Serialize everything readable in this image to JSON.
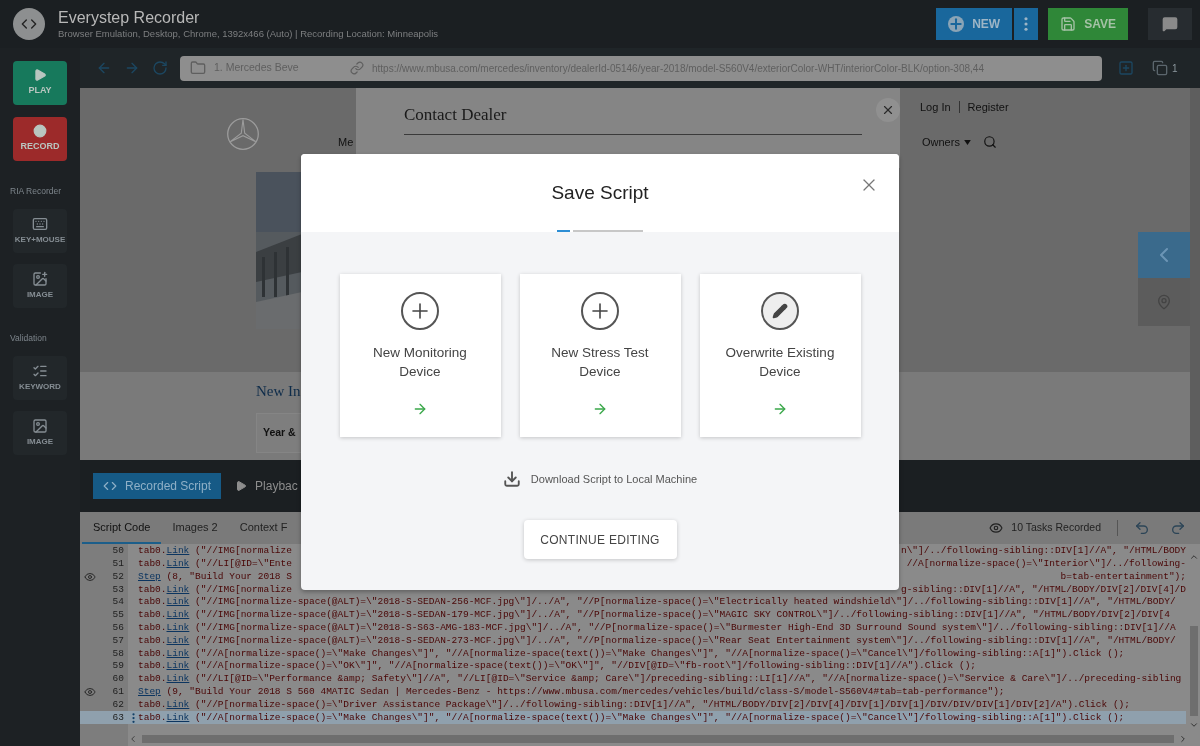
{
  "app": {
    "title": "Everystep Recorder",
    "subtitle": "Browser Emulation, Desktop, Chrome, 1392x466 (Auto) | Recording Location: Minneapolis"
  },
  "header_buttons": [
    {
      "kind": "new",
      "label": "NEW"
    },
    {
      "kind": "more"
    },
    {
      "kind": "save",
      "label": "SAVE"
    },
    {
      "kind": "chat"
    }
  ],
  "sidebar": {
    "primary": [
      {
        "kind": "play",
        "label": "PLAY"
      },
      {
        "kind": "record",
        "label": "RECORD"
      }
    ],
    "sections": [
      {
        "title": "RIA Recorder",
        "items": [
          {
            "kind": "key-mouse",
            "label": "KEY+MOUSE"
          },
          {
            "label": "IMAGE"
          }
        ]
      },
      {
        "title": "Validation",
        "items": [
          {
            "kind": "keyword",
            "label": "KEYWORD"
          },
          {
            "kind": "image-check",
            "label": "IMAGE"
          }
        ]
      }
    ]
  },
  "browser": {
    "tab_title": "1. Mercedes Beve",
    "url": "https://www.mbusa.com/mercedes/inventory/dealerId-05146/year-2018/model-S560V4/exteriorColor-WHT/interiorColor-BLK/option-308,44",
    "tab_count": "1"
  },
  "web_page": {
    "nav_fragment": "Me",
    "top_links": [
      "Log In",
      "Register"
    ],
    "menu": "Owners",
    "contact_panel": {
      "title": "Contact Dealer"
    },
    "heading_fragment": "New In",
    "filter_fragment": "Year &"
  },
  "bottom_tabs": [
    {
      "kind": "code",
      "label": "Recorded Script",
      "selected": true
    },
    {
      "kind": "play",
      "label": "Playbac",
      "selected": false
    }
  ],
  "sub_tabs": [
    {
      "label": "Script Code",
      "selected": true
    },
    {
      "label": "Images",
      "count": "2",
      "selected": false
    },
    {
      "label": "Context F",
      "selected": false
    }
  ],
  "tasks_recorded": "10 Tasks Recorded",
  "code_lines": [
    {
      "number": "50",
      "watched": false,
      "current": false,
      "object": "tab0.",
      "method": "Link",
      "args": " (\"//IMG[normalize",
      "args_right": "n\\\"]/../following-sibling::DIV[1]//A\", \"/HTML/BODY"
    },
    {
      "number": "51",
      "watched": false,
      "current": false,
      "object": "tab0.",
      "method": "Link",
      "args": " (\"//LI[@ID=\\\"Ente",
      "args_right": "//A[normalize-space()=\\\"Interior\\\"]/../following-"
    },
    {
      "number": "52",
      "watched": true,
      "current": false,
      "method": "Step",
      "args": " (8, \"Build Your 2018 S",
      "args_right": "b=tab-entertainment\");"
    },
    {
      "number": "53",
      "watched": false,
      "current": false,
      "object": "tab0.",
      "method": "Link",
      "args": " (\"//IMG[normalize",
      "args_right": "g-sibling::DIV[1]//A\", \"/HTML/BODY/DIV[2]/DIV[4]/D"
    },
    {
      "number": "54",
      "watched": false,
      "current": false,
      "object": "tab0.",
      "method": "Link",
      "args": " (\"//IMG[normalize-space(@ALT)=\\\"2018-S-SEDAN-256-MCF.jpg\\\"]/../A\", \"//P[normalize-space()=\\\"Electrically heated windshield\\\"]/../following-sibling::DIV[1]//A\", \"/HTML/BODY/"
    },
    {
      "number": "55",
      "watched": false,
      "current": false,
      "object": "tab0.",
      "method": "Link",
      "args": " (\"//IMG[normalize-space(@ALT)=\\\"2018-S-SEDAN-179-MCF.jpg\\\"]/../A\", \"//P[normalize-space()=\\\"MAGIC SKY CONTROL\\\"]/../following-sibling::DIV[1]//A\", \"/HTML/BODY/DIV[2]/DIV[4"
    },
    {
      "number": "56",
      "watched": false,
      "current": false,
      "object": "tab0.",
      "method": "Link",
      "args": " (\"//IMG[normalize-space(@ALT)=\\\"2018-S-S63-AMG-183-MCF.jpg\\\"]/../A\", \"//P[normalize-space()=\\\"Burmester High-End 3D Surround Sound system\\\"]/../following-sibling::DIV[1]//A"
    },
    {
      "number": "57",
      "watched": false,
      "current": false,
      "object": "tab0.",
      "method": "Link",
      "args": " (\"//IMG[normalize-space(@ALT)=\\\"2018-S-SEDAN-273-MCF.jpg\\\"]/../A\", \"//P[normalize-space()=\\\"Rear Seat Entertainment system\\\"]/../following-sibling::DIV[1]//A\", \"/HTML/BODY/"
    },
    {
      "number": "58",
      "watched": false,
      "current": false,
      "object": "tab0.",
      "method": "Link",
      "args": " (\"//A[normalize-space()=\\\"Make Changes\\\"]\", \"//A[normalize-space(text())=\\\"Make Changes\\\"]\", \"//A[normalize-space()=\\\"Cancel\\\"]/following-sibling::A[1]\").Click ();"
    },
    {
      "number": "59",
      "watched": false,
      "current": false,
      "object": "tab0.",
      "method": "Link",
      "args": " (\"//A[normalize-space()=\\\"OK\\\"]\", \"//A[normalize-space(text())=\\\"OK\\\"]\", \"//DIV[@ID=\\\"fb-root\\\"]/following-sibling::DIV[1]//A\").Click ();"
    },
    {
      "number": "60",
      "watched": false,
      "current": false,
      "object": "tab0.",
      "method": "Link",
      "args": " (\"//LI[@ID=\\\"Performance &amp; Safety\\\"]//A\", \"//LI[@ID=\\\"Service &amp; Care\\\"]/preceding-sibling::LI[1]//A\", \"//A[normalize-space()=\\\"Service & Care\\\"]/../preceding-sibling"
    },
    {
      "number": "61",
      "watched": true,
      "current": false,
      "method": "Step",
      "args": " (9, \"Build Your 2018 S 560 4MATIC Sedan | Mercedes-Benz - https://www.mbusa.com/mercedes/vehicles/build/class-S/model-S560V4#tab=tab-performance\");"
    },
    {
      "number": "62",
      "watched": false,
      "current": false,
      "object": "tab0.",
      "method": "Link",
      "args": " (\"//P[normalize-space()=\\\"Driver Assistance Package\\\"]/../following-sibling::DIV[1]//A\", \"/HTML/BODY/DIV[2]/DIV[4]/DIV[1]/DIV[1]/DIV/DIV/DIV[1]/DIV[2]/A\").Click ();"
    },
    {
      "number": "63",
      "watched": false,
      "current": true,
      "object": "tab0.",
      "method": "Link",
      "args": " (\"//A[normalize-space()=\\\"Make Changes\\\"]\", \"//A[normalize-space(text())=\\\"Make Changes\\\"]\", \"//A[normalize-space()=\\\"Cancel\\\"]/following-sibling::A[1]\").Click ();"
    }
  ],
  "modal": {
    "title": "Save Script",
    "steps": [
      {
        "selected": true
      },
      {
        "selected": false
      }
    ],
    "options": [
      {
        "kind": "add",
        "label": "New Monitoring Device"
      },
      {
        "kind": "add",
        "label": "New Stress Test Device"
      },
      {
        "kind": "edit",
        "label": "Overwrite Existing Device"
      }
    ],
    "download": "Download Script to Local Machine",
    "continue_button": "CONTINUE EDITING"
  }
}
